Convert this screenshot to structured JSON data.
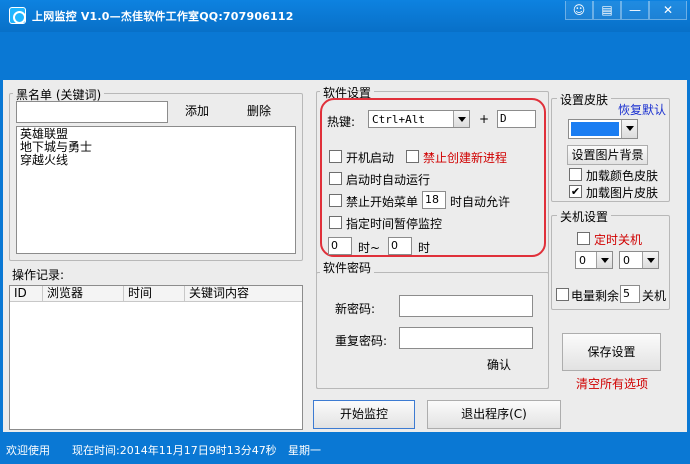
{
  "window": {
    "title": "上网监控 V1.0—杰佳软件工作室QQ:707906112",
    "buttons": {
      "skin": "☺",
      "menu": "▤",
      "minimize": "—",
      "close": "✕"
    }
  },
  "blacklist": {
    "group_label": "黑名单 (关键词)",
    "input_value": "",
    "add_label": "添加",
    "delete_label": "删除",
    "items": [
      "英雄联盟",
      "地下城与勇士",
      "穿越火线"
    ]
  },
  "log": {
    "label": "操作记录:",
    "columns": [
      "ID",
      "浏览器",
      "时间",
      "关键词内容"
    ]
  },
  "settings": {
    "group_label": "软件设置",
    "hotkey_label": "热键:",
    "hotkey_value": "Ctrl+Alt",
    "hotkey_plus": "+",
    "hotkey_key": "D",
    "autostart_label": "开机启动",
    "block_new_process_label": "禁止创建新进程",
    "auto_run_label": "启动时自动运行",
    "block_start_menu_label": "禁止开始菜单",
    "start_menu_hour": "18",
    "start_menu_suffix": "时自动允许",
    "pause_label": "指定时间暂停监控",
    "pause_from": "0",
    "pause_mid": "时~",
    "pause_to": "0",
    "pause_end": "时"
  },
  "password": {
    "group_label": "软件密码",
    "new_label": "新密码:",
    "repeat_label": "重复密码:",
    "new_value": "",
    "repeat_value": "",
    "confirm_label": "确认"
  },
  "skin": {
    "group_label": "设置皮肤",
    "restore_label": "恢复默认",
    "color_value": "#1a7df2",
    "image_bg_label": "设置图片背景",
    "load_color_label": "加载颜色皮肤",
    "load_image_label": "加载图片皮肤"
  },
  "shutdown": {
    "group_label": "关机设置",
    "timed_label": "定时关机",
    "hour": "0",
    "minute": "0",
    "battery_label": "电量剩余",
    "battery_value": "5",
    "battery_suffix": "关机"
  },
  "actions": {
    "save_label": "保存设置",
    "clear_label": "清空所有选项",
    "start_label": "开始监控",
    "exit_label": "退出程序(C)"
  },
  "status": {
    "welcome": "欢迎使用",
    "time_text": "现在时间:2014年11月17日9时13分47秒",
    "weekday": "星期一"
  }
}
